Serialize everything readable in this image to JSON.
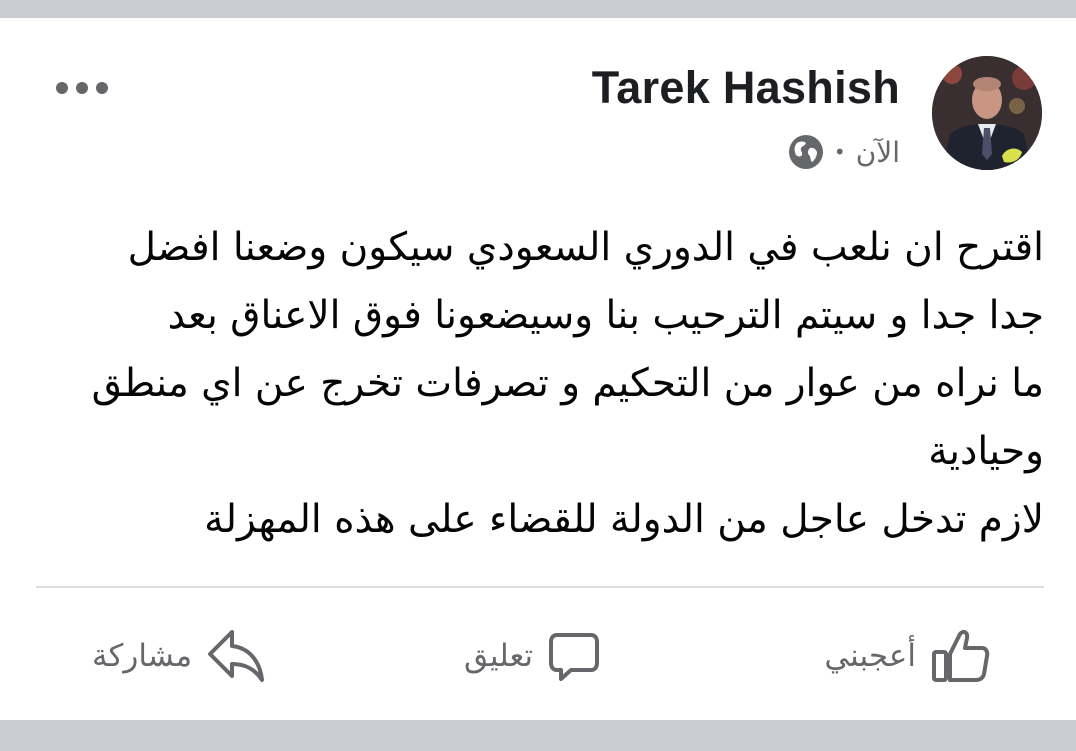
{
  "post": {
    "author": "Tarek Hashish",
    "time": "الآن",
    "separator": "•",
    "audience_icon": "globe-icon",
    "menu_icon": "more-options-icon",
    "body_lines": [
      "اقترح ان نلعب في الدوري السعودي سيكون وضعنا افضل",
      "جدا جدا و سيتم الترحيب  بنا وسيضعونا فوق الاعناق بعد",
      "ما نراه من عوار من التحكيم و تصرفات تخرج عن اي منطق",
      "وحيادية",
      "لازم تدخل عاجل من الدولة للقضاء على هذه المهزلة"
    ]
  },
  "actions": {
    "like": {
      "label": "أعجبني",
      "icon": "like-icon"
    },
    "comment": {
      "label": "تعليق",
      "icon": "comment-icon"
    },
    "share": {
      "label": "مشاركة",
      "icon": "share-icon"
    }
  },
  "colors": {
    "page_background": "#c9ccd1",
    "card": "#ffffff",
    "text_primary": "#050505",
    "text_secondary": "#65676b"
  }
}
